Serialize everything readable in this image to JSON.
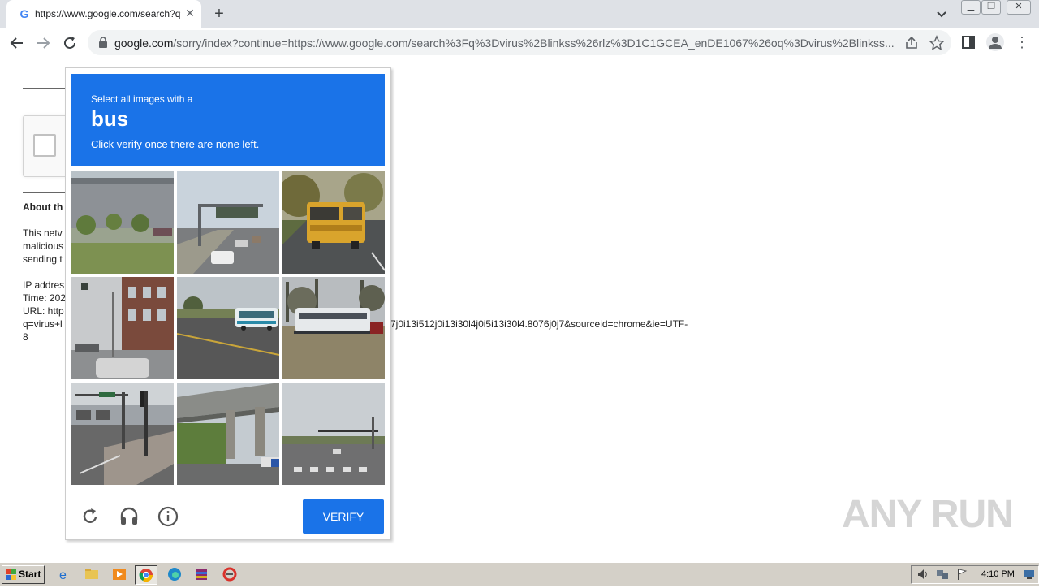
{
  "browser": {
    "tab_title": "https://www.google.com/search?q=",
    "tab_close": "✕",
    "new_tab": "+",
    "url_domain": "google.com",
    "url_path": "/sorry/index?continue=https://www.google.com/search%3Fq%3Dvirus%2Blinkss%26rlz%3D1C1GCEA_enDE1067%26oq%3Dvirus%2Blinkss..."
  },
  "page": {
    "about_heading": "About th",
    "para_lines": [
      "This netv",
      "malicious",
      "sending t"
    ],
    "ip_line": "IP addres",
    "time_line": "Time: 202",
    "url_line": "URL: http",
    "query_line_start": "q=virus+l",
    "query_line_end": "7j0i13i512j0i13i30l4j0i5i13i30l4.8076j0j7&sourceid=chrome&ie=UTF-",
    "query_line_wrap": "8"
  },
  "captcha": {
    "instruction_line1": "Select all images with a",
    "target": "bus",
    "instruction_line2": "Click verify once there are none left.",
    "verify_label": "VERIFY",
    "tiles": [
      {
        "name": "tile-building-trees"
      },
      {
        "name": "tile-highway-sign"
      },
      {
        "name": "tile-school-bus"
      },
      {
        "name": "tile-street-building"
      },
      {
        "name": "tile-road-bus"
      },
      {
        "name": "tile-white-bus"
      },
      {
        "name": "tile-traffic-lights"
      },
      {
        "name": "tile-overpass"
      },
      {
        "name": "tile-crosswalk"
      }
    ]
  },
  "watermark": "ANY RUN",
  "taskbar": {
    "start_label": "Start",
    "clock": "4:10 PM"
  },
  "colors": {
    "accent": "#1a73e8",
    "taskbar": "#d4d0c8"
  }
}
